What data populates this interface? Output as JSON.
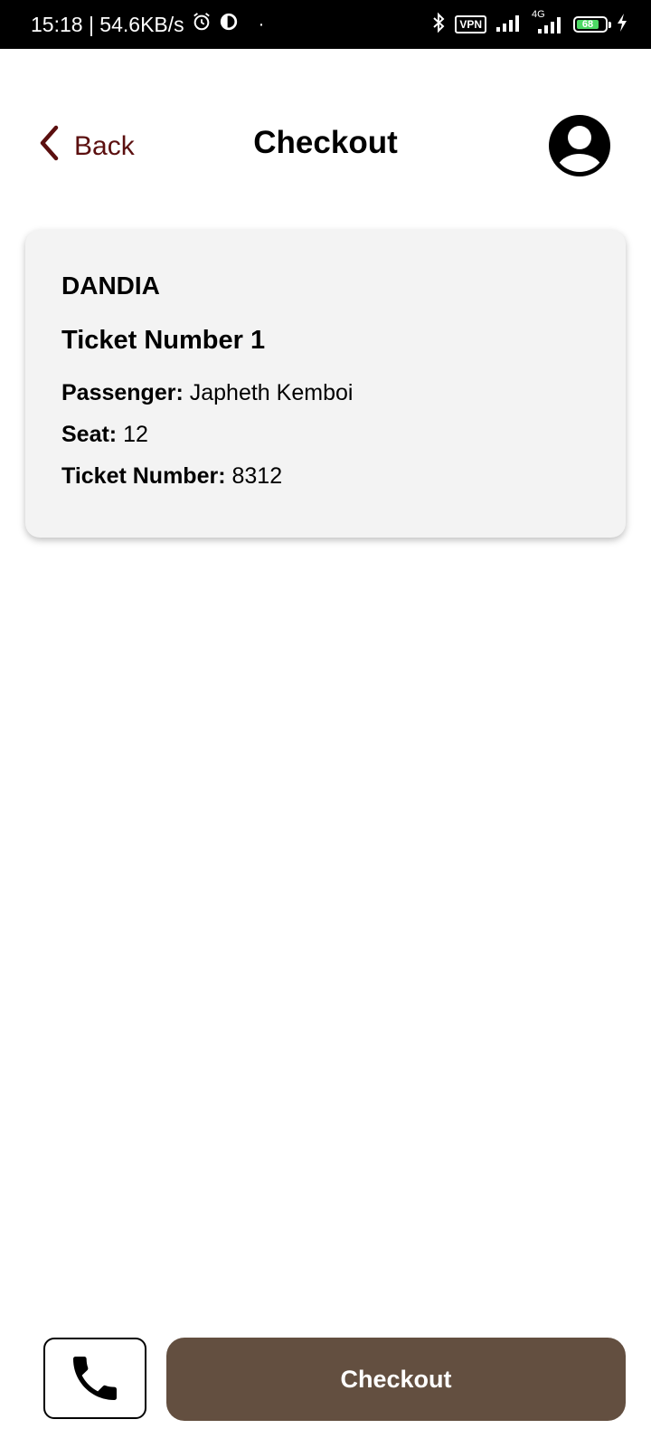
{
  "status_bar": {
    "time_speed": "15:18 | 54.6KB/s",
    "dot": "·",
    "vpn": "VPN",
    "network": "4G",
    "battery": "68",
    "icons": [
      "alarm-icon",
      "app-notification-icon",
      "bluetooth-icon",
      "signal-icon",
      "charging-icon"
    ]
  },
  "header": {
    "back_label": "Back",
    "title": "Checkout",
    "back_icon": "chevron-left-icon",
    "profile_icon": "user-profile-icon"
  },
  "ticket": {
    "event": "DANDIA",
    "title": "Ticket Number 1",
    "passenger_label": "Passenger:",
    "passenger_value": "Japheth Kemboi",
    "seat_label": "Seat:",
    "seat_value": "12",
    "ticket_number_label": "Ticket Number:",
    "ticket_number_value": "8312"
  },
  "footer": {
    "call_icon": "phone-icon",
    "checkout_label": "Checkout"
  },
  "colors": {
    "accent_dark_red": "#5b0f0f",
    "checkout_brown": "#634f40",
    "card_bg": "#f3f3f3",
    "battery_green": "#4cd964"
  }
}
